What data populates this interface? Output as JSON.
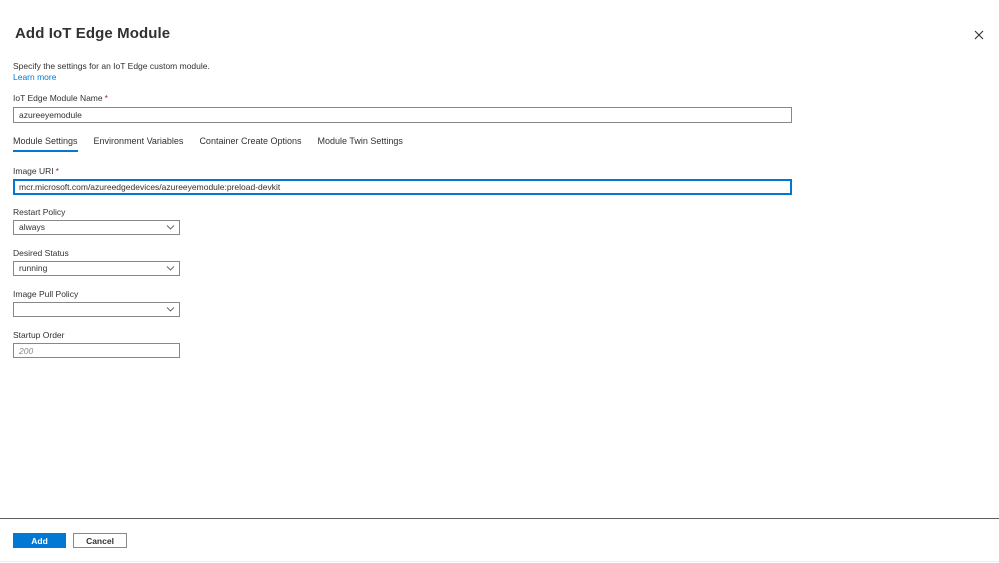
{
  "panel": {
    "title": "Add IoT Edge Module",
    "close_icon": "close-icon",
    "description": "Specify the settings for an IoT Edge custom module.",
    "learn_more": "Learn more"
  },
  "module_name": {
    "label": "IoT Edge Module Name",
    "required_mark": "*",
    "value": "azureeyemodule"
  },
  "tabs": [
    {
      "label": "Module Settings",
      "active": true
    },
    {
      "label": "Environment Variables",
      "active": false
    },
    {
      "label": "Container Create Options",
      "active": false
    },
    {
      "label": "Module Twin Settings",
      "active": false
    }
  ],
  "module_settings": {
    "image_uri": {
      "label": "Image URI",
      "required_mark": "*",
      "value": "mcr.microsoft.com/azureedgedevices/azureeyemodule:preload-devkit"
    },
    "restart_policy": {
      "label": "Restart Policy",
      "value": "always"
    },
    "desired_status": {
      "label": "Desired Status",
      "value": "running"
    },
    "image_pull_policy": {
      "label": "Image Pull Policy",
      "value": ""
    },
    "startup_order": {
      "label": "Startup Order",
      "placeholder": "200"
    }
  },
  "footer": {
    "add_label": "Add",
    "cancel_label": "Cancel"
  },
  "colors": {
    "accent": "#0078d4",
    "text": "#323130",
    "border": "#8a8886",
    "required": "#a4262c"
  }
}
